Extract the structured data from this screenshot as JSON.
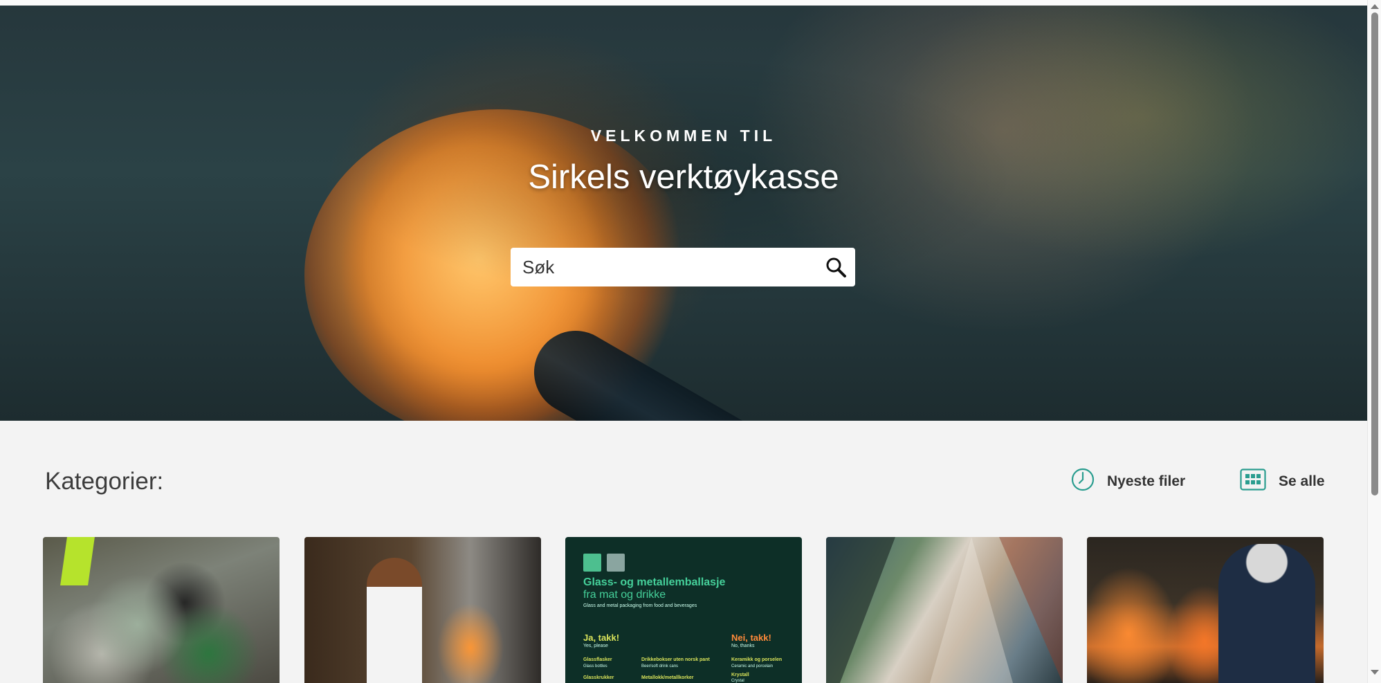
{
  "hero": {
    "eyebrow": "VELKOMMEN TIL",
    "title": "Sirkels verktøykasse"
  },
  "search": {
    "placeholder": "Søk",
    "icon": "search-icon"
  },
  "categories": {
    "heading": "Kategorier:",
    "newest_label": "Nyeste filer",
    "newest_icon": "clock-icon",
    "all_label": "Se alle",
    "all_icon": "grid-icon"
  },
  "cards": [
    {
      "alt": "glass-sorting-photo"
    },
    {
      "alt": "glassblower-photo"
    },
    {
      "title_line1": "Glass- og metallemballasje",
      "title_line2": "fra mat og drikke",
      "subtitle": "Glass and metal packaging from food and beverages",
      "yes": "Ja, takk!",
      "yes_sub": "Yes, please",
      "no": "Nei, takk!",
      "no_sub": "No, thanks",
      "item1": "Glassflasker",
      "item1_sub": "Glass bottles",
      "item2": "Drikkebokser uten norsk pant",
      "item2_sub": "Beer/soft drink cans",
      "item3": "Glasskrukker",
      "item4": "Metallokk/metallkorker",
      "item5": "Keramikk og porselen",
      "item5_sub": "Ceramic and porcelain",
      "item6": "Krystall",
      "item6_sub": "Crystal"
    },
    {
      "alt": "people-collage-photo"
    },
    {
      "alt": "factory-worker-photo"
    }
  ],
  "colors": {
    "accent": "#2a9d8f",
    "background": "#f3f3f3",
    "card_green": "#0d2f27"
  }
}
